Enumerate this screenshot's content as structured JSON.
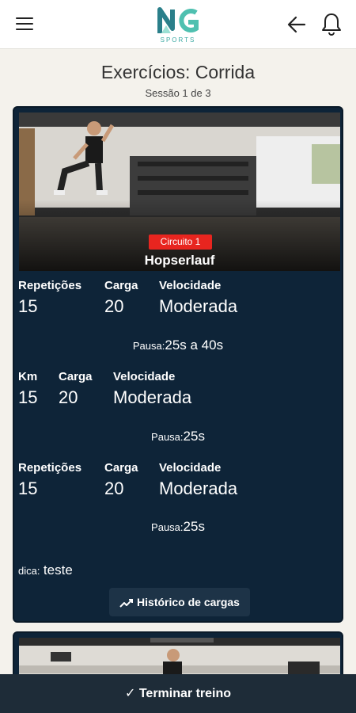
{
  "header": {
    "menu_icon": "hamburger-menu-icon",
    "logo_text": "SPORTS",
    "back_icon": "arrow-left-icon",
    "notification_icon": "bell-icon",
    "brand_color": "#3aa9a2"
  },
  "page": {
    "title": "Exercícios: Corrida",
    "session": "Sessão 1 de 3"
  },
  "exercise": {
    "circuit_label": "Circuito 1",
    "name": "Hopserlauf",
    "circuit_badge_color": "#e8251f",
    "sets": [
      {
        "col1_label": "Repetições",
        "col1_value": "15",
        "col2_label": "Carga",
        "col2_value": "20",
        "col3_label": "Velocidade",
        "col3_value": "Moderada",
        "pause_label": "Pausa:",
        "pause_value": "25s a 40s"
      },
      {
        "col1_label": "Km",
        "col1_value": "15",
        "col2_label": "Carga",
        "col2_value": "20",
        "col3_label": "Velocidade",
        "col3_value": "Moderada",
        "pause_label": "Pausa:",
        "pause_value": "25s"
      },
      {
        "col1_label": "Repetições",
        "col1_value": "15",
        "col2_label": "Carga",
        "col2_value": "20",
        "col3_label": "Velocidade",
        "col3_value": "Moderada",
        "pause_label": "Pausa:",
        "pause_value": "25s"
      }
    ],
    "tip_label": "dica:",
    "tip_value": "teste",
    "history_button": "Histórico de cargas",
    "history_icon": "trending-up-icon"
  },
  "footer": {
    "finish_button": "✓ Terminar treino"
  }
}
